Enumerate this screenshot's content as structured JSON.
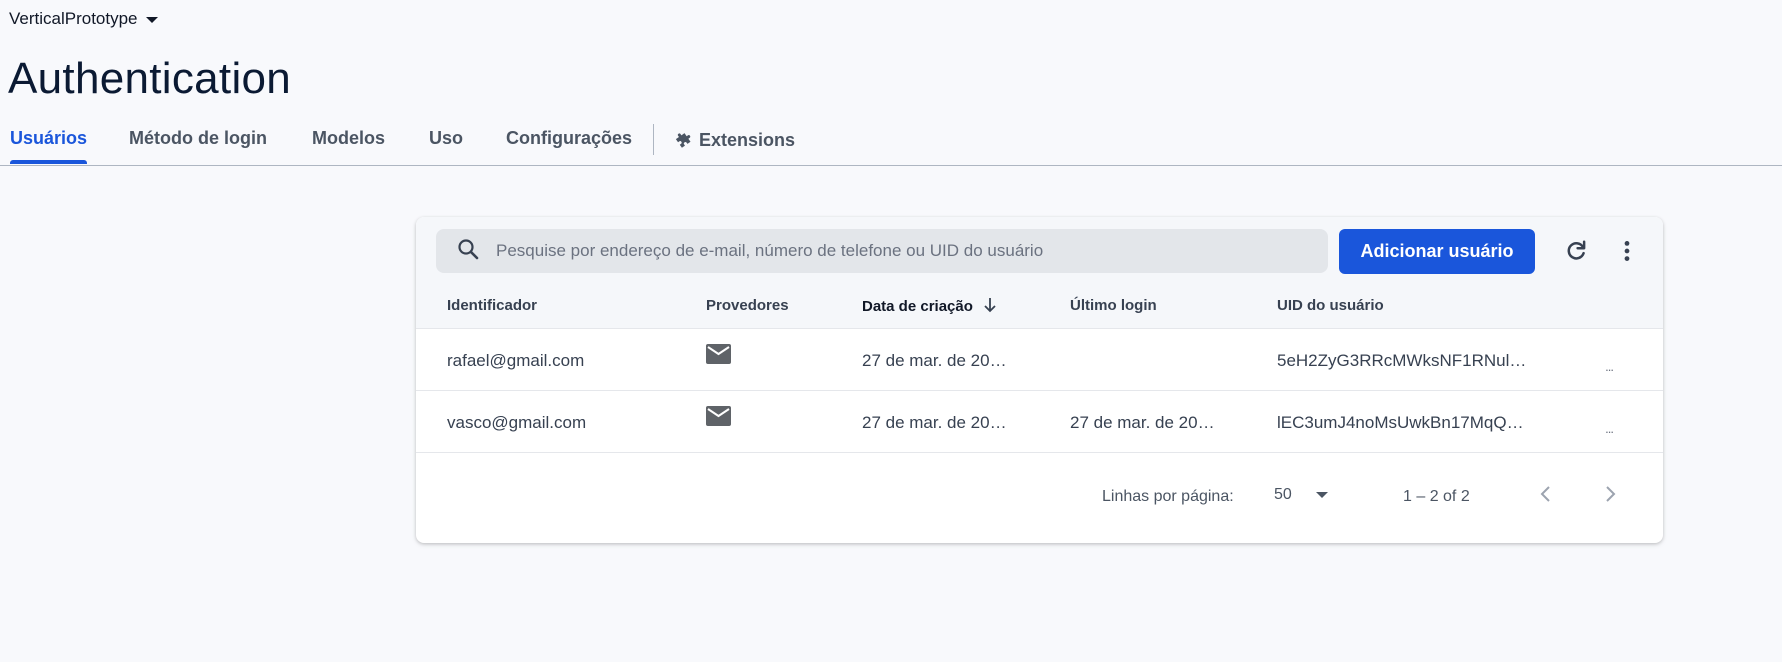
{
  "header": {
    "project_name": "VerticalPrototype",
    "title": "Authentication"
  },
  "tabs": [
    {
      "label": "Usuários",
      "active": true
    },
    {
      "label": "Método de login"
    },
    {
      "label": "Modelos"
    },
    {
      "label": "Uso"
    },
    {
      "label": "Configurações"
    },
    {
      "label": "Extensions",
      "icon": "extensions-icon"
    }
  ],
  "toolbar": {
    "search_placeholder": "Pesquise por endereço de e-mail, número de telefone ou UID do usuário",
    "add_user_label": "Adicionar usuário",
    "refresh_icon": "refresh-icon",
    "more_icon": "more-vert-icon"
  },
  "table": {
    "columns": [
      "Identificador",
      "Provedores",
      "Data de criação",
      "Último login",
      "UID do usuário"
    ],
    "sorted_column": "Data de criação",
    "rows": [
      {
        "identifier": "rafael@gmail.com",
        "provider": "email-icon",
        "created": "27 de mar. de 20…",
        "last_login": "",
        "uid": "5eH2ZyG3RRcMWksNF1RNul…",
        "more": "..."
      },
      {
        "identifier": "vasco@gmail.com",
        "provider": "email-icon",
        "created": "27 de mar. de 20…",
        "last_login": "27 de mar. de 20…",
        "uid": "lEC3umJ4noMsUwkBn17MqQ…",
        "more": "..."
      }
    ]
  },
  "pagination": {
    "rows_per_page_label": "Linhas por página:",
    "rows_per_page": "50",
    "range": "1 – 2 of 2"
  },
  "colors": {
    "accent": "#1a56db",
    "background": "#f8f9fc",
    "title": "#0b1a33"
  }
}
